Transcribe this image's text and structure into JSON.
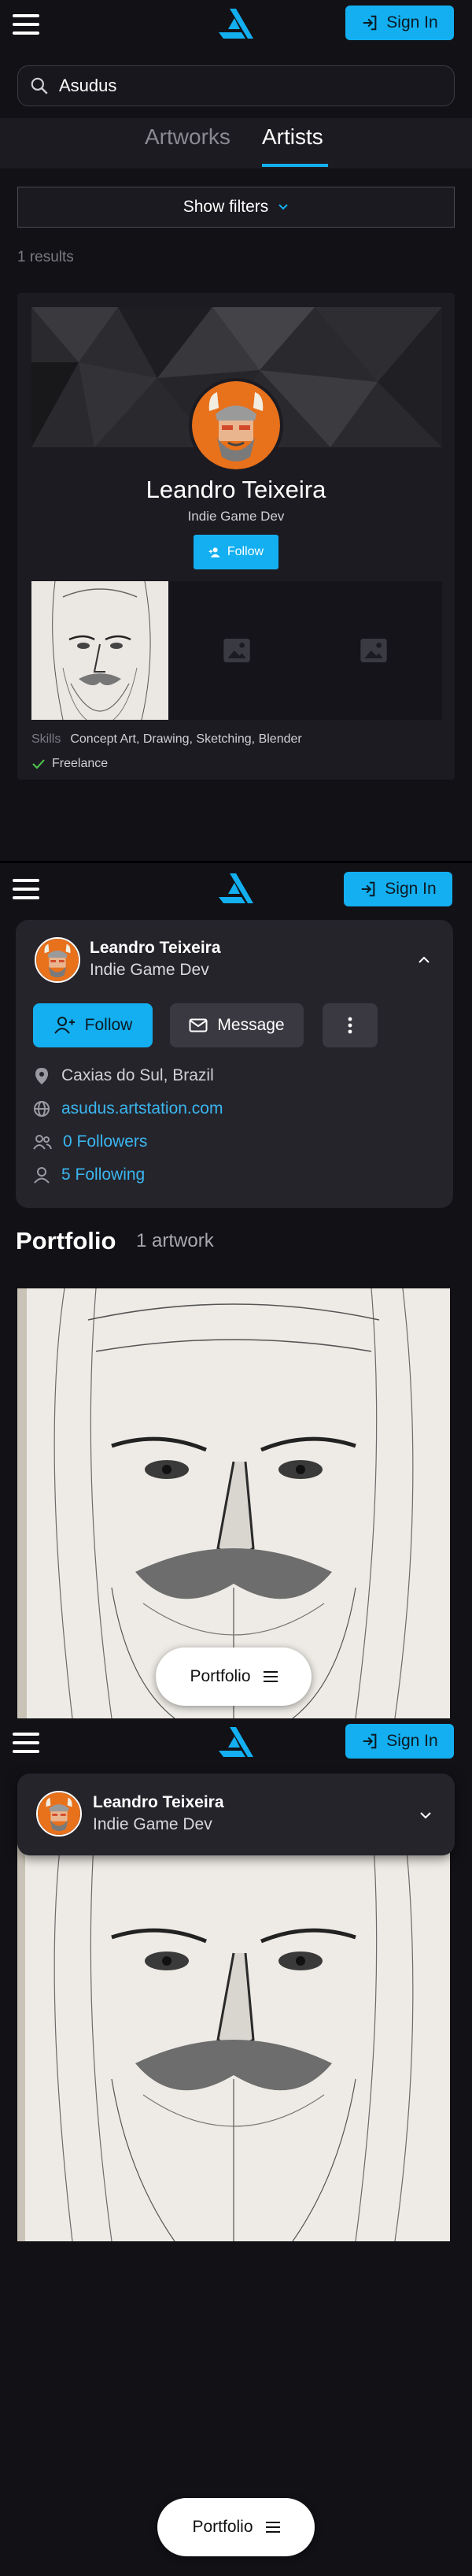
{
  "header": {
    "signin_label": "Sign In"
  },
  "search": {
    "value": "Asudus",
    "placeholder": "Search"
  },
  "tabs": [
    {
      "label": "Artworks"
    },
    {
      "label": "Artists"
    }
  ],
  "filters": {
    "label": "Show filters"
  },
  "results": {
    "count_text": "1 results"
  },
  "artist_card": {
    "name": "Leandro Teixeira",
    "headline": "Indie Game Dev",
    "follow_label": "Follow",
    "skills_label": "Skills",
    "skills": "Concept Art, Drawing, Sketching, Blender",
    "freelance_label": "Freelance"
  },
  "profile": {
    "name": "Leandro Teixeira",
    "headline": "Indie Game Dev",
    "follow_label": "Follow",
    "message_label": "Message",
    "location": "Caxias do Sul, Brazil",
    "website": "asudus.artstation.com",
    "followers_count": "0",
    "followers_label": "Followers",
    "following_count": "5",
    "following_label": "Following"
  },
  "portfolio": {
    "heading": "Portfolio",
    "artwork_count": "1 artwork",
    "pill_label": "Portfolio"
  },
  "colors": {
    "accent": "#13aff0",
    "background": "#121116",
    "panel": "#25242b"
  }
}
